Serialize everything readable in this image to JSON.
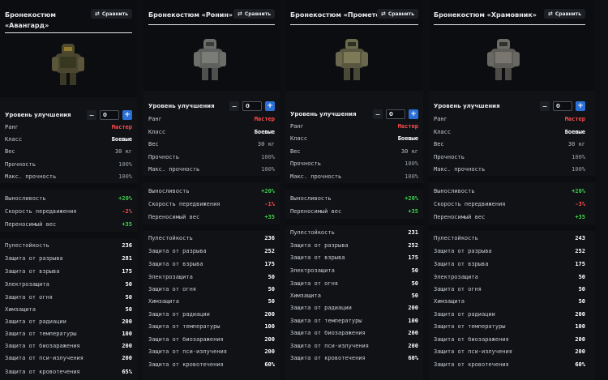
{
  "cards": [
    {
      "title": "Бронекостюм «Авангард»",
      "compare_label": "Сравнить",
      "upgrade_label": "Уровень улучшения",
      "upgrade_value": "0",
      "general": [
        {
          "label": "Ранг",
          "value": "Мастер"
        },
        {
          "label": "Класс",
          "value": "Боевые"
        },
        {
          "label": "Вес",
          "value": "30 кг"
        },
        {
          "label": "Прочность",
          "value": "100%"
        },
        {
          "label": "Макс. прочность",
          "value": "100%"
        }
      ],
      "bonuses": [
        {
          "label": "Выносливость",
          "value": "+20%"
        },
        {
          "label": "Скорость передвижения",
          "value": "-2%"
        },
        {
          "label": "Переносимый вес",
          "value": "+35"
        }
      ],
      "protection": [
        {
          "label": "Пулестойкость",
          "value": "236"
        },
        {
          "label": "Защита от разрыва",
          "value": "281"
        },
        {
          "label": "Защита от взрыва",
          "value": "175"
        },
        {
          "label": "Электрозащита",
          "value": "50"
        },
        {
          "label": "Защита от огня",
          "value": "50"
        },
        {
          "label": "Химзащита",
          "value": "50"
        },
        {
          "label": "Защита от радиации",
          "value": "200"
        },
        {
          "label": "Защита от температуры",
          "value": "100"
        },
        {
          "label": "Защита от биозаражения",
          "value": "200"
        },
        {
          "label": "Защита от пси-излучения",
          "value": "200"
        },
        {
          "label": "Защита от кровотечения",
          "value": "65%"
        }
      ]
    },
    {
      "title": "Бронекостюм «Ронин»",
      "compare_label": "Сравнить",
      "upgrade_label": "Уровень улучшения",
      "upgrade_value": "0",
      "general": [
        {
          "label": "Ранг",
          "value": "Мастер"
        },
        {
          "label": "Класс",
          "value": "Боевые"
        },
        {
          "label": "Вес",
          "value": "30 кг"
        },
        {
          "label": "Прочность",
          "value": "100%"
        },
        {
          "label": "Макс. прочность",
          "value": "100%"
        }
      ],
      "bonuses": [
        {
          "label": "Выносливость",
          "value": "+20%"
        },
        {
          "label": "Скорость передвижения",
          "value": "-1%"
        },
        {
          "label": "Переносимый вес",
          "value": "+35"
        }
      ],
      "protection": [
        {
          "label": "Пулестойкость",
          "value": "236"
        },
        {
          "label": "Защита от разрыва",
          "value": "252"
        },
        {
          "label": "Защита от взрыва",
          "value": "175"
        },
        {
          "label": "Электрозащита",
          "value": "50"
        },
        {
          "label": "Защита от огня",
          "value": "50"
        },
        {
          "label": "Химзащита",
          "value": "50"
        },
        {
          "label": "Защита от радиации",
          "value": "200"
        },
        {
          "label": "Защита от температуры",
          "value": "100"
        },
        {
          "label": "Защита от биозаражения",
          "value": "200"
        },
        {
          "label": "Защита от пси-излучения",
          "value": "200"
        },
        {
          "label": "Защита от кровотечения",
          "value": "60%"
        }
      ]
    },
    {
      "title": "Бронекостюм «Прометей»",
      "compare_label": "Сравнить",
      "upgrade_label": "Уровень улучшения",
      "upgrade_value": "0",
      "general": [
        {
          "label": "Ранг",
          "value": "Мастер"
        },
        {
          "label": "Класс",
          "value": "Боевые"
        },
        {
          "label": "Вес",
          "value": "30 кг"
        },
        {
          "label": "Прочность",
          "value": "100%"
        },
        {
          "label": "Макс. прочность",
          "value": "100%"
        }
      ],
      "bonuses": [
        {
          "label": "Выносливость",
          "value": "+20%"
        },
        {
          "label": "Переносимый вес",
          "value": "+35"
        }
      ],
      "protection": [
        {
          "label": "Пулестойкость",
          "value": "231"
        },
        {
          "label": "Защита от разрыва",
          "value": "252"
        },
        {
          "label": "Защита от взрыва",
          "value": "175"
        },
        {
          "label": "Электрозащита",
          "value": "50"
        },
        {
          "label": "Защита от огня",
          "value": "50"
        },
        {
          "label": "Химзащита",
          "value": "50"
        },
        {
          "label": "Защита от радиации",
          "value": "200"
        },
        {
          "label": "Защита от температуры",
          "value": "100"
        },
        {
          "label": "Защита от биозаражения",
          "value": "200"
        },
        {
          "label": "Защита от пси-излучения",
          "value": "200"
        },
        {
          "label": "Защита от кровотечения",
          "value": "60%"
        }
      ]
    },
    {
      "title": "Бронекостюм «Храмовник»",
      "compare_label": "Сравнить",
      "upgrade_label": "Уровень улучшения",
      "upgrade_value": "0",
      "general": [
        {
          "label": "Ранг",
          "value": "Мастер"
        },
        {
          "label": "Класс",
          "value": "Боевые"
        },
        {
          "label": "Вес",
          "value": "30 кг"
        },
        {
          "label": "Прочность",
          "value": "100%"
        },
        {
          "label": "Макс. прочность",
          "value": "100%"
        }
      ],
      "bonuses": [
        {
          "label": "Выносливость",
          "value": "+20%"
        },
        {
          "label": "Скорость передвижения",
          "value": "-3%"
        },
        {
          "label": "Переносимый вес",
          "value": "+35"
        }
      ],
      "protection": [
        {
          "label": "Пулестойкость",
          "value": "243"
        },
        {
          "label": "Защита от разрыва",
          "value": "252"
        },
        {
          "label": "Защита от взрыва",
          "value": "175"
        },
        {
          "label": "Электрозащита",
          "value": "50"
        },
        {
          "label": "Защита от огня",
          "value": "50"
        },
        {
          "label": "Химзащита",
          "value": "50"
        },
        {
          "label": "Защита от радиации",
          "value": "200"
        },
        {
          "label": "Защита от температуры",
          "value": "100"
        },
        {
          "label": "Защита от биозаражения",
          "value": "200"
        },
        {
          "label": "Защита от пси-излучения",
          "value": "200"
        },
        {
          "label": "Защита от кровотечения",
          "value": "60%"
        }
      ]
    }
  ],
  "colors": {
    "rank": "#ff4d4d",
    "negative": "#ff4d4d",
    "positive": "#3fd14a",
    "accent": "#2b6fd6"
  },
  "icons": [
    "minus-icon",
    "plus-icon",
    "compare-icon",
    "armor-suit-image"
  ]
}
